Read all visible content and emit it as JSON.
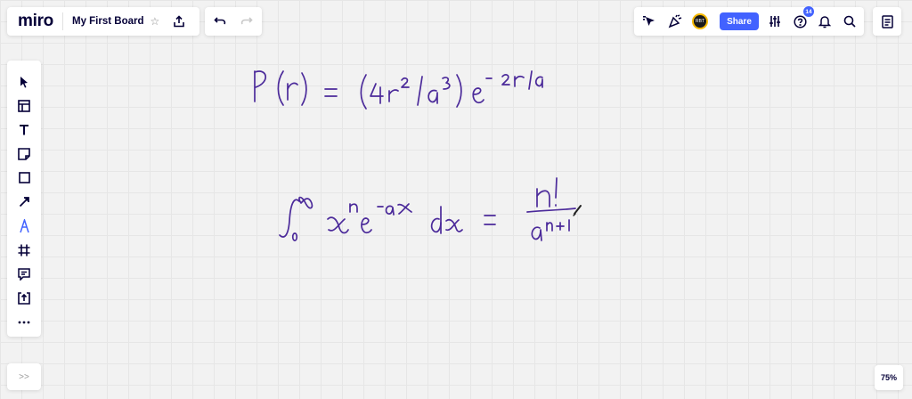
{
  "app": {
    "logo": "miro",
    "board_name": "My First Board",
    "star": "☆"
  },
  "top_right": {
    "share_label": "Share",
    "notification_count": "14",
    "avatar_text": "RBT"
  },
  "zoom": {
    "level": "75%"
  },
  "left_toolbar": {
    "tools": [
      {
        "name": "select-tool",
        "icon": "cursor-icon"
      },
      {
        "name": "templates-tool",
        "icon": "template-icon"
      },
      {
        "name": "text-tool",
        "icon": "text-icon"
      },
      {
        "name": "sticky-note-tool",
        "icon": "sticky-note-icon"
      },
      {
        "name": "shape-tool",
        "icon": "square-icon"
      },
      {
        "name": "connection-line-tool",
        "icon": "arrow-icon"
      },
      {
        "name": "pen-tool",
        "icon": "pen-icon",
        "active": true
      },
      {
        "name": "frame-tool",
        "icon": "frame-icon"
      },
      {
        "name": "comment-tool",
        "icon": "comment-icon"
      },
      {
        "name": "upload-tool",
        "icon": "upload-icon"
      },
      {
        "name": "more-tools",
        "icon": "more-icon"
      }
    ]
  },
  "bottom_left": {
    "expand_label": ">>"
  },
  "colors": {
    "accent": "#4262ff",
    "ink": "#4b2a9a",
    "text": "#050038"
  },
  "canvas": {
    "equation_1": "P(r) = (4r²/a³) e^(−2r/a)",
    "equation_2": "∫₀^∞ xⁿ e^(−ax) dx = n! / a^(n+1)"
  }
}
